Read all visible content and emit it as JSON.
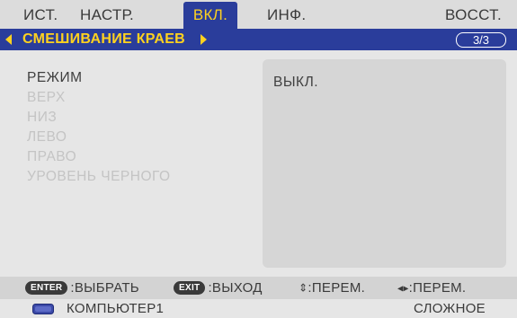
{
  "tabs": [
    {
      "label": "ИСТ.",
      "active": false
    },
    {
      "label": "НАСТР.",
      "active": false
    },
    {
      "label": "ВКЛ.",
      "active": true
    },
    {
      "label": "ИНФ.",
      "active": false
    },
    {
      "label": "ВОССТ.",
      "active": false
    }
  ],
  "submenu": {
    "title": "СМЕШИВАНИЕ КРАЕВ",
    "page": "3/3"
  },
  "menu_items": [
    {
      "label": "РЕЖИМ",
      "enabled": true
    },
    {
      "label": "ВЕРХ",
      "enabled": false
    },
    {
      "label": "НИЗ",
      "enabled": false
    },
    {
      "label": "ЛЕВО",
      "enabled": false
    },
    {
      "label": "ПРАВО",
      "enabled": false
    },
    {
      "label": "УРОВЕНЬ ЧЕРНОГО",
      "enabled": false
    }
  ],
  "value": "ВЫКЛ.",
  "footer": {
    "enter_key": "ENTER",
    "enter_action": ":ВЫБРАТЬ",
    "exit_key": "EXIT",
    "exit_action": ":ВЫХОД",
    "updown_glyph": "⇕",
    "updown_action": ":ПЕРЕМ.",
    "leftright_glyph": "◂▸",
    "leftright_action": ":ПЕРЕМ."
  },
  "status": {
    "source_icon": "computer-input-icon",
    "source": "КОМПЬЮТЕР1",
    "menu_mode": "СЛОЖНОЕ"
  },
  "colors": {
    "accent": "#2a3d9b",
    "highlight_text": "#ffd21f",
    "background": "#e6e6e6",
    "disabled_text": "#c4c4c4"
  }
}
